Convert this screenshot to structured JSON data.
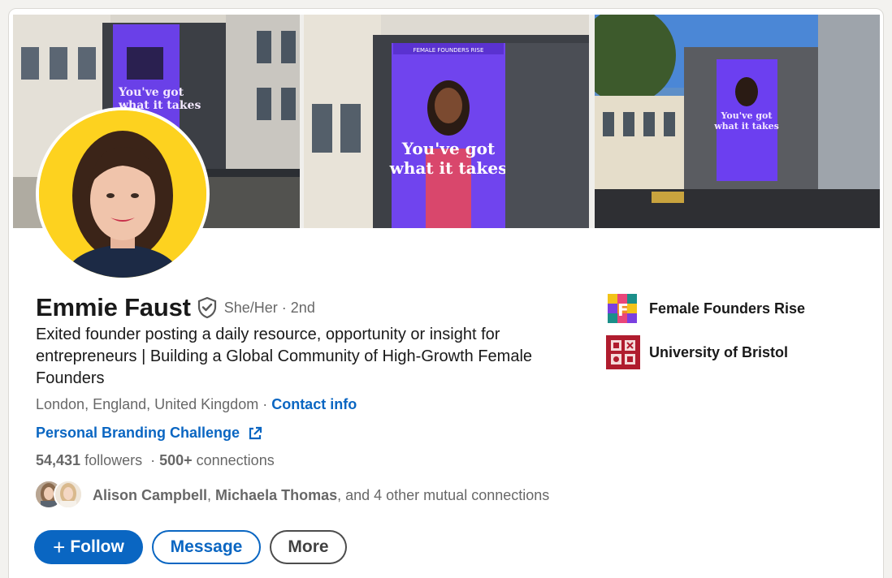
{
  "profile": {
    "name": "Emmie Faust",
    "pronouns": "She/Her",
    "separator": "·",
    "degree": "2nd",
    "headline": "Exited founder posting a daily resource, opportunity or insight for entrepreneurs | Building a Global Community of High-Growth Female Founders",
    "location": "London, England, United Kingdom",
    "location_separator": " · ",
    "contact_info": "Contact info",
    "website": "Personal Branding Challenge",
    "followers_count": "54,431",
    "followers_label": " followers",
    "stats_separator": "  · ",
    "connections_count": "500+",
    "connections_label": " connections",
    "mutual": {
      "name1": "Alison Campbell",
      "comma": ", ",
      "name2": "Michaela Thomas",
      "rest": ", and 4 other mutual connections"
    }
  },
  "banner": {
    "poster_headline": "You've got what it takes",
    "poster_brand": "FEMALE FOUNDERS RISE"
  },
  "actions": {
    "follow_plus": "+",
    "follow": "Follow",
    "message": "Message",
    "more": "More"
  },
  "side": {
    "company": "Female Founders Rise",
    "school": "University of Bristol"
  },
  "icons": {
    "verified": "shield-check-icon",
    "external": "external-link-icon"
  },
  "colors": {
    "linkedin_blue": "#0a66c2",
    "avatar_bg": "#fdd21f",
    "bristol_red": "#b01c2e",
    "poster_purple": "#6b3df0"
  }
}
